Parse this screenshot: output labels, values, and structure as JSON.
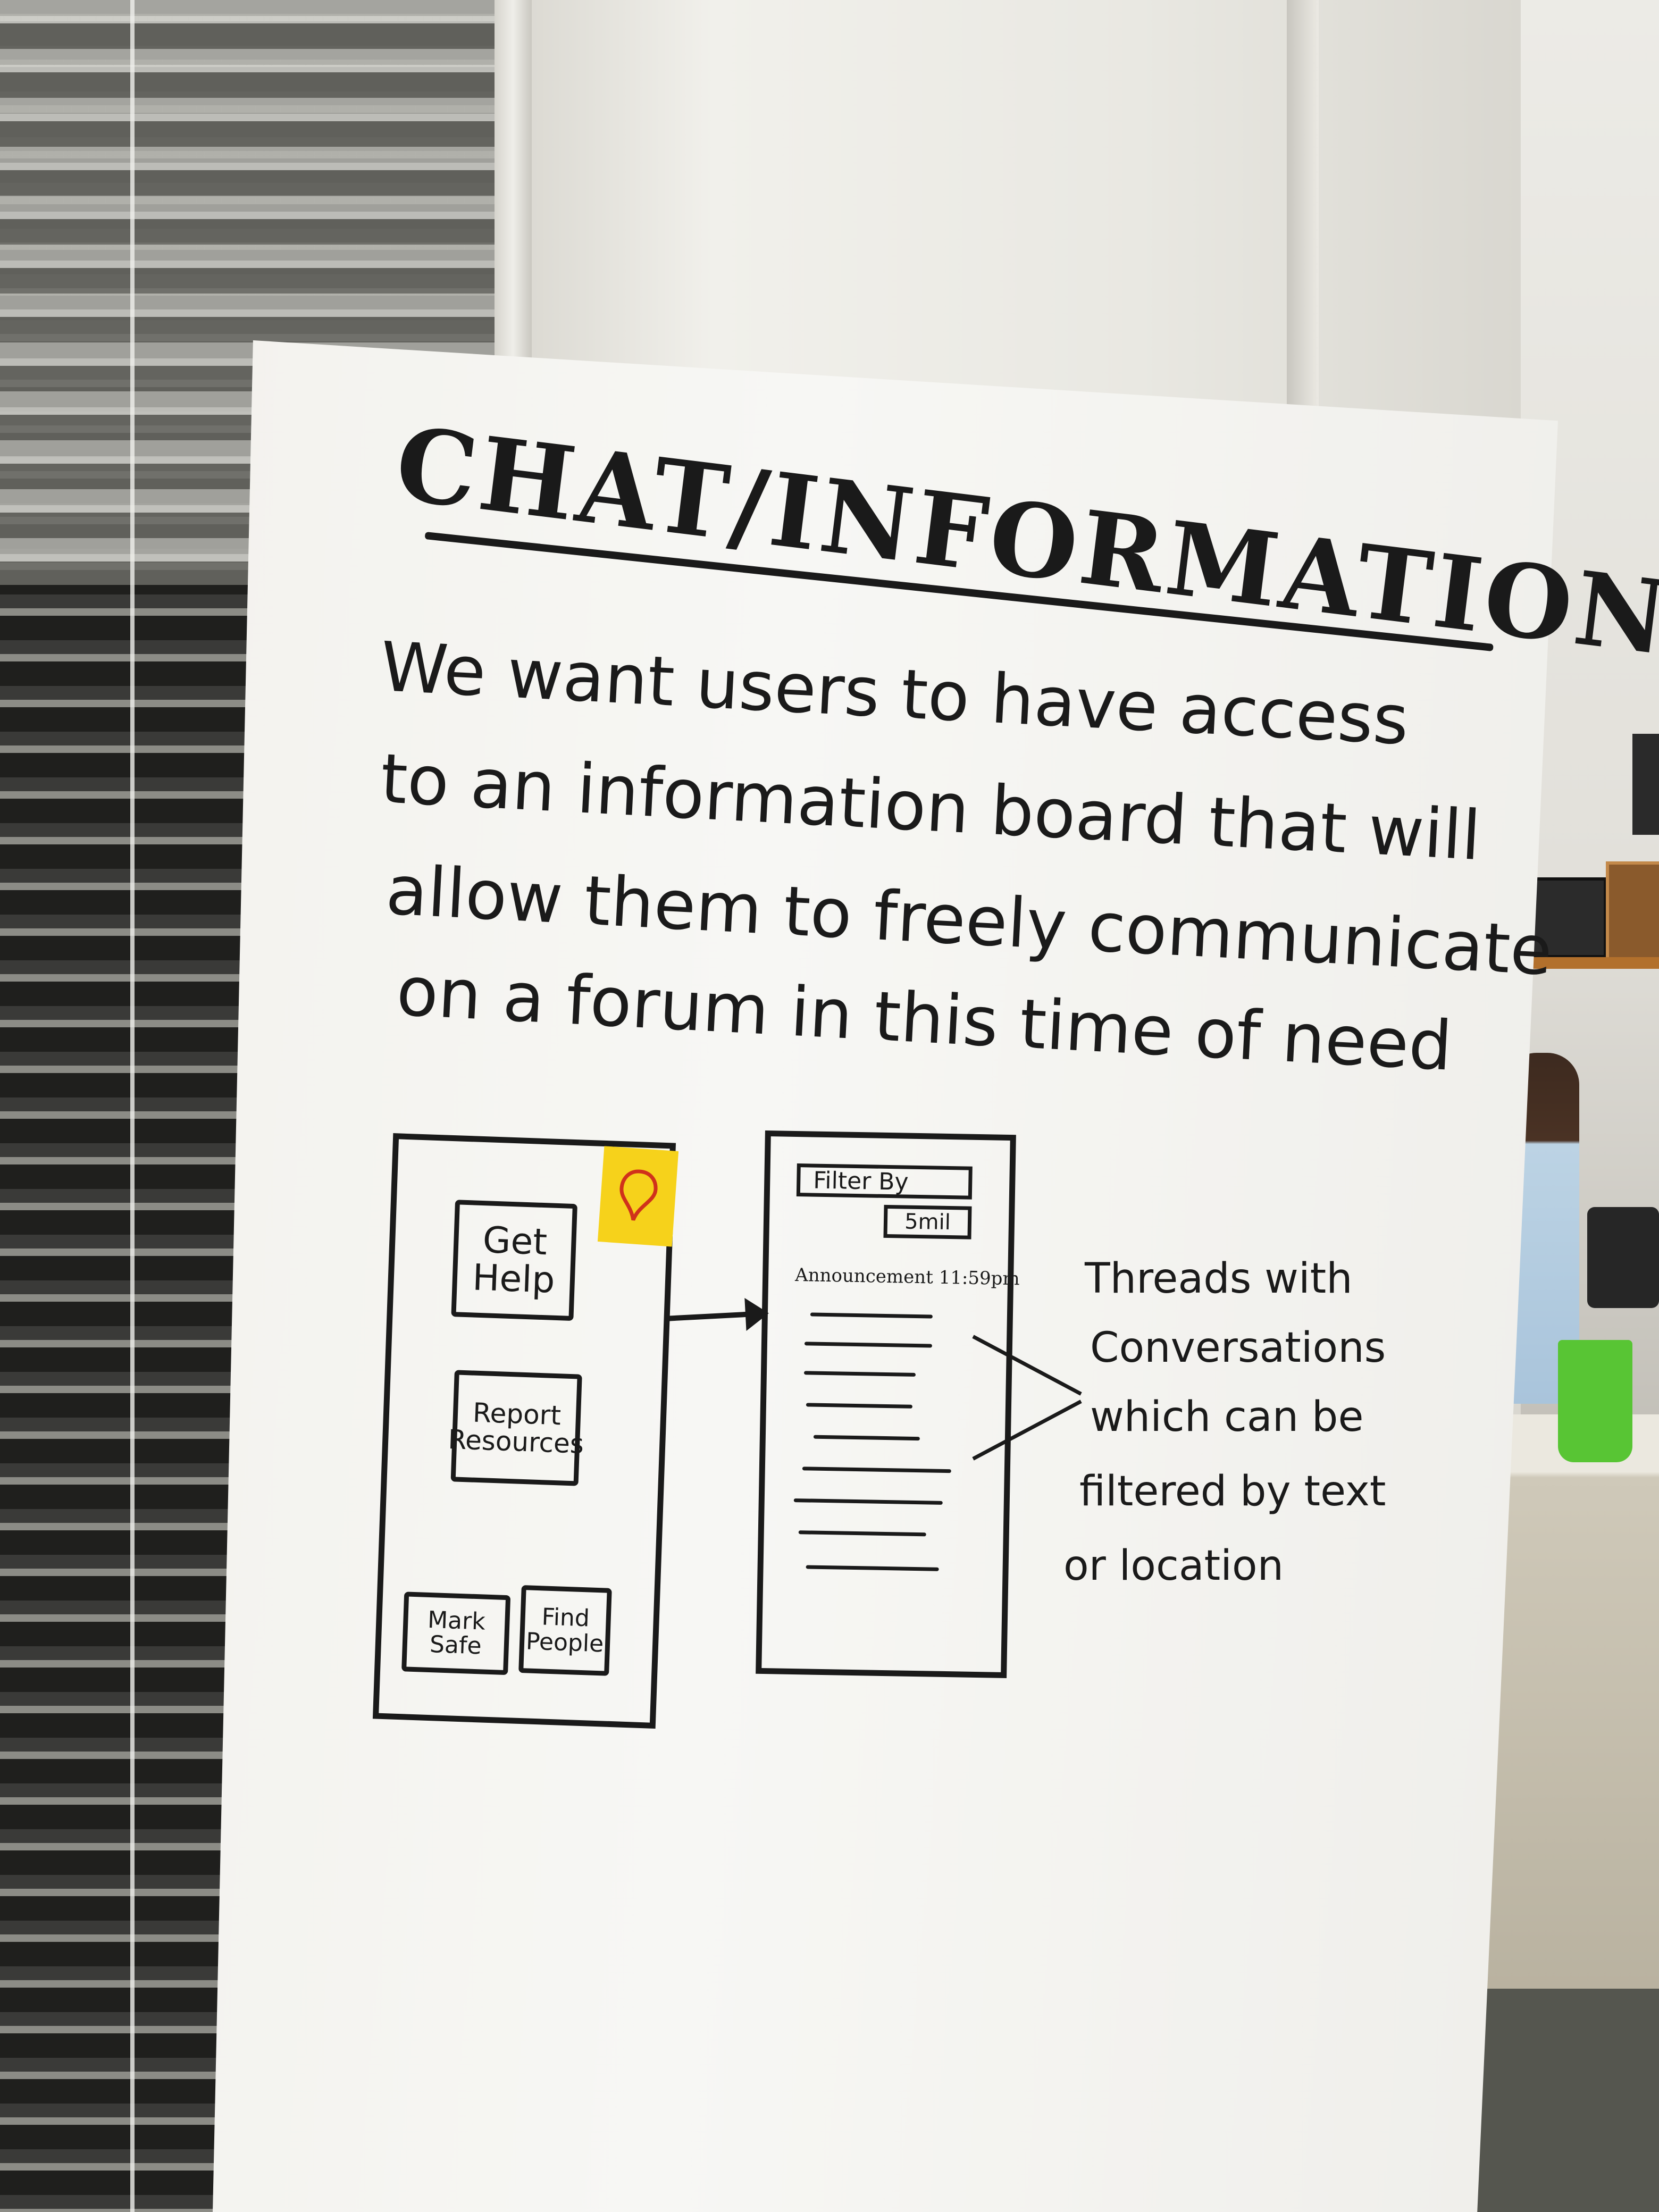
{
  "poster": {
    "title": "CHAT/INFORMATION BOARD",
    "body_lines": [
      "We want users to have access",
      "to an information board that will",
      "allow them to freely communicate",
      "on a forum in this time of need"
    ]
  },
  "sketch": {
    "home_screen": {
      "get_help_label": "Get Help",
      "report_resources_label": "Report Resources",
      "mark_safe_label": "Mark Safe",
      "find_people_label": "Find People",
      "sticky_icon": "location-pin-icon"
    },
    "board_screen": {
      "filter_label": "Filter By",
      "filter_value": "5mil",
      "announcement_label": "Announcement 11:59pm",
      "thread_count": 9
    },
    "annotation_lines": [
      "Threads with",
      "Conversations",
      "which can be",
      "filtered by text",
      "or location"
    ]
  },
  "colors": {
    "ink": "#1a1a1a",
    "paper": "#f5f5f2",
    "sticky_note": "#f6d21b",
    "cup": "#58c534"
  }
}
